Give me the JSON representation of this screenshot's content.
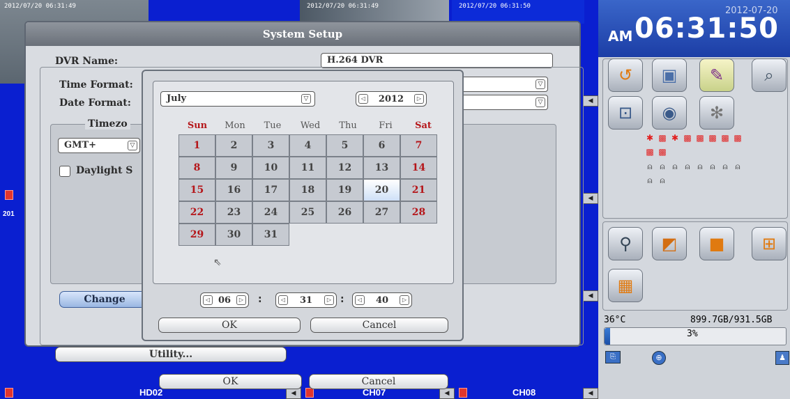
{
  "cameras": {
    "timestamps": [
      "2012/07/20 06:31:49",
      "2012/07/20 06:31:50",
      "2012/07/20 06:31:49"
    ],
    "side_label": "201",
    "bottom_labels": [
      "HD02",
      "CH07",
      "CH08"
    ]
  },
  "right_panel": {
    "date": "2012-07-20",
    "ampm": "AM",
    "time": "06:31:50",
    "function_icons": [
      "power-menu-icon",
      "camera-setup-icon",
      "notepad-icon",
      "search-film-icon",
      "monitor-lock-icon",
      "webcam-icon",
      "sprocket-icon"
    ],
    "layout_icons": [
      "magnifier-icon",
      "single-view-icon",
      "full-view-icon",
      "quad-view-icon",
      "nine-view-icon"
    ],
    "temperature": "36°C",
    "disk": "899.7GB/931.5GB",
    "disk_percent": "3%",
    "disk_fraction": 0.03,
    "bottom_icons": [
      "network-icon",
      "globe-icon",
      "user-icon"
    ]
  },
  "system_setup": {
    "title": "System Setup",
    "dvr_name_label": "DVR Name:",
    "dvr_name_value": "H.264 DVR",
    "time_format_label": "Time Format:",
    "date_format_label": "Date Format:",
    "timezone_label": "Timezo",
    "gmt_value": "GMT+",
    "daylight_label": "Daylight S",
    "change_label": "Change",
    "utility_label": "Utility...",
    "ok_label": "OK",
    "cancel_label": "Cancel"
  },
  "calendar": {
    "month": "July",
    "year": "2012",
    "weekdays": [
      "Sun",
      "Mon",
      "Tue",
      "Wed",
      "Thu",
      "Fri",
      "Sat"
    ],
    "weeks": [
      [
        "1",
        "2",
        "3",
        "4",
        "5",
        "6",
        "7"
      ],
      [
        "8",
        "9",
        "10",
        "11",
        "12",
        "13",
        "14"
      ],
      [
        "15",
        "16",
        "17",
        "18",
        "19",
        "20",
        "21"
      ],
      [
        "22",
        "23",
        "24",
        "25",
        "26",
        "27",
        "28"
      ],
      [
        "29",
        "30",
        "31",
        "",
        "",
        "",
        ""
      ]
    ],
    "selected_day": "20",
    "hour": "06",
    "minute": "31",
    "second": "40",
    "ok_label": "OK",
    "cancel_label": "Cancel"
  }
}
